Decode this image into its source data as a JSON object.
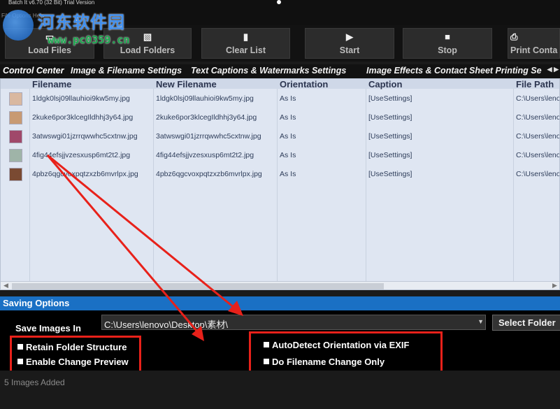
{
  "window": {
    "title": "Batch It v6.70 (32 Bit) Trial Version",
    "menu": "File  Options  Help"
  },
  "watermark": {
    "title": "河东软件园",
    "url": "www.pc0359.cn"
  },
  "toolbar": {
    "buttons": [
      {
        "label": "Load Files",
        "icon": "load-files-icon"
      },
      {
        "label": "Load Folders",
        "icon": "load-folders-icon"
      },
      {
        "label": "Clear List",
        "icon": "clear-list-icon"
      },
      {
        "label": "Start",
        "icon": "start-icon"
      },
      {
        "label": "Stop",
        "icon": "stop-icon"
      },
      {
        "label": "Print Conta",
        "icon": "print-icon"
      }
    ]
  },
  "tabs": [
    "Control Center",
    "Image & Filename Settings",
    "Text Captions & Watermarks Settings",
    "Image Effects & Contact Sheet Printing Se"
  ],
  "table": {
    "columns": [
      "Filename",
      "New Filename",
      "Orientation",
      "Caption",
      "File Path"
    ],
    "rows": [
      {
        "filename": "1ldgk0lsj09llauhioi9kw5my.jpg",
        "new_filename": "1ldgk0lsj09llauhioi9kw5my.jpg",
        "orientation": "As Is",
        "caption": "[UseSettings]",
        "path": "C:\\Users\\lenov"
      },
      {
        "filename": "2kuke6por3klcegIldhhj3y64.jpg",
        "new_filename": "2kuke6por3klcegIldhhj3y64.jpg",
        "orientation": "As Is",
        "caption": "[UseSettings]",
        "path": "C:\\Users\\lenov"
      },
      {
        "filename": "3atwswgi01jzrrqwwhc5cxtnw.jpg",
        "new_filename": "3atwswgi01jzrrqwwhc5cxtnw.jpg",
        "orientation": "As Is",
        "caption": "[UseSettings]",
        "path": "C:\\Users\\lenov"
      },
      {
        "filename": "4fig44efsjjvzesxusp6mt2t2.jpg",
        "new_filename": "4fig44efsjjvzesxusp6mt2t2.jpg",
        "orientation": "As Is",
        "caption": "[UseSettings]",
        "path": "C:\\Users\\lenov"
      },
      {
        "filename": "4pbz6qgcvoxpqtzxzb6mvrlpx.jpg",
        "new_filename": "4pbz6qgcvoxpqtzxzb6mvrlpx.jpg",
        "orientation": "As Is",
        "caption": "[UseSettings]",
        "path": "C:\\Users\\lenov"
      }
    ]
  },
  "saving": {
    "header": "Saving Options",
    "save_label": "Save Images In",
    "path_value": "C:\\Users\\lenovo\\Desktop\\素材\\",
    "select_folder": "Select Folder",
    "options": {
      "retain_folder_structure": "Retain Folder Structure",
      "enable_change_preview": "Enable Change Preview",
      "autodetect_orientation": "AutoDetect Orientation via EXIF",
      "do_filename_change_only": "Do Filename Change Only"
    }
  },
  "status": {
    "text": "5 Images Added"
  },
  "colors": {
    "accent": "#1a70c4",
    "highlight": "#e8211a",
    "grid_bg": "#dfe6f2"
  }
}
